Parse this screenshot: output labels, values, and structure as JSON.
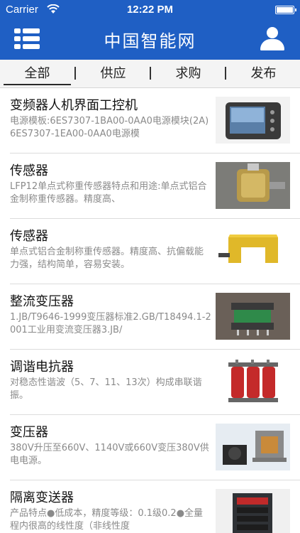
{
  "status_bar": {
    "carrier": "Carrier",
    "time": "12:22 PM"
  },
  "header": {
    "title": "中国智能网",
    "menu_icon": "list-menu-icon",
    "user_icon": "user-icon",
    "bg_color": "#1f5fc4"
  },
  "tabs": [
    {
      "label": "全部",
      "active": true
    },
    {
      "label": "供应",
      "active": false
    },
    {
      "label": "求购",
      "active": false
    },
    {
      "label": "发布",
      "active": false
    }
  ],
  "items": [
    {
      "title": "变频器人机界面工控机",
      "desc": "电源模板:6ES7307-1BA00-0AA0电源模块(2A)6ES7307-1EA00-0AA0电源模",
      "image": "rugged-tablet-image"
    },
    {
      "title": "传感器",
      "desc": "LFP12单点式称重传感器特点和用途:单点式铝合金制称重传感器。精度高、",
      "image": "load-sensor-image"
    },
    {
      "title": "传感器",
      "desc": "单点式铝合金制称重传感器。精度高、抗偏载能力强，结构简单，容易安装。",
      "image": "fork-sensor-image"
    },
    {
      "title": "整流变压器",
      "desc": "1.JB/T9646-1999变压器标准2.GB/T18494.1-2001工业用变流变压器3.JB/",
      "image": "rectifier-transformer-image"
    },
    {
      "title": "调谐电抗器",
      "desc": "对稳态性谐波（5、7、11、13次）构成串联谐振。",
      "image": "tuning-reactor-image"
    },
    {
      "title": "变压器",
      "desc": "380V升压至660V、1140V或660V变压380V供电电源。",
      "image": "transformer-image"
    },
    {
      "title": "隔离变送器",
      "desc": "产品特点●低成本，精度等级：0.1级0.2●全量程内很高的线性度（非线性度",
      "image": "isolation-transmitter-image"
    }
  ]
}
